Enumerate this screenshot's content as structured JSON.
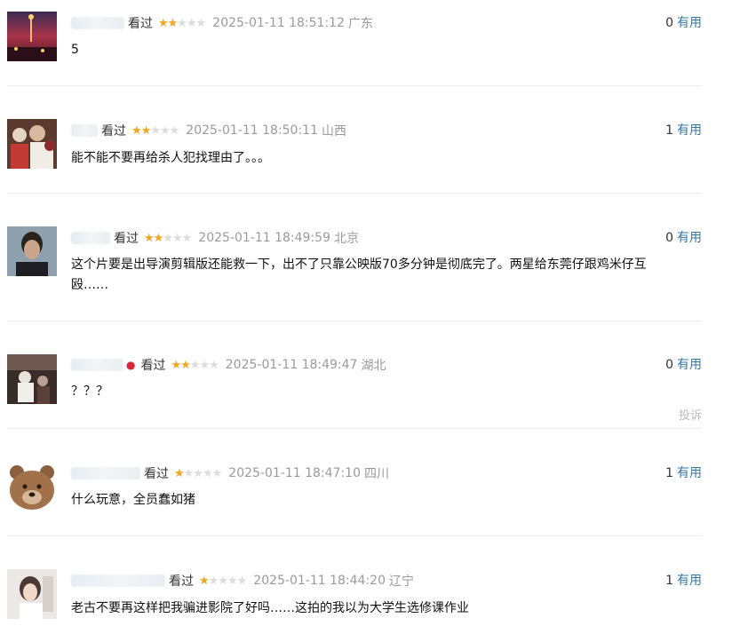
{
  "reviews": [
    {
      "watched": "看过",
      "stars": 2,
      "time": "2025-01-11 18:51:12",
      "location": "广东",
      "useful_count": "0",
      "useful_label": "有用",
      "content": "5"
    },
    {
      "watched": "看过",
      "stars": 2,
      "time": "2025-01-11 18:50:11",
      "location": "山西",
      "useful_count": "1",
      "useful_label": "有用",
      "content": "能不能不要再给杀人犯找理由了。。。"
    },
    {
      "watched": "看过",
      "stars": 2,
      "time": "2025-01-11 18:49:59",
      "location": "北京",
      "useful_count": "0",
      "useful_label": "有用",
      "content": "这个片要是出导演剪辑版还能救一下，出不了只靠公映版70多分钟是彻底完了。两星给东莞仔跟鸡米仔互殴……"
    },
    {
      "watched": "看过",
      "stars": 2,
      "time": "2025-01-11 18:49:47",
      "location": "湖北",
      "useful_count": "0",
      "useful_label": "有用",
      "content": "？？？",
      "report_label": "投诉"
    },
    {
      "watched": "看过",
      "stars": 1,
      "time": "2025-01-11 18:47:10",
      "location": "四川",
      "useful_count": "1",
      "useful_label": "有用",
      "content": "什么玩意，全员蠢如猪"
    },
    {
      "watched": "看过",
      "stars": 1,
      "time": "2025-01-11 18:44:20",
      "location": "辽宁",
      "useful_count": "1",
      "useful_label": "有用",
      "content": "老古不要再这样把我骗进影院了好吗……这拍的我以为大学生选修课作业"
    }
  ],
  "colors": {
    "star": "#f5a623",
    "star_empty": "#dcdcdc",
    "link": "#3377aa",
    "meta": "#9a9a9a"
  },
  "icons": {
    "badge": "strawberry-icon"
  }
}
